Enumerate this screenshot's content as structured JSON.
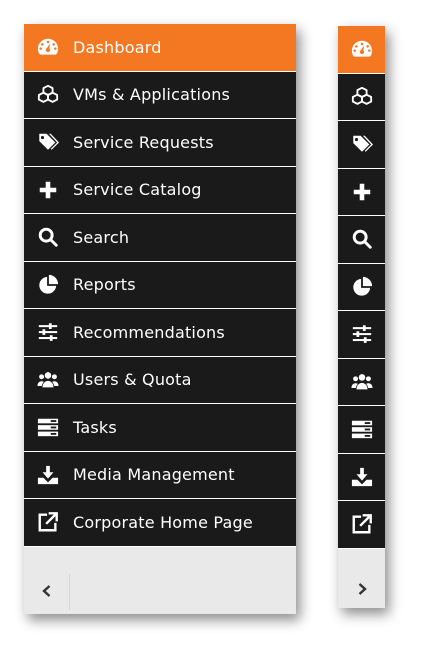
{
  "colors": {
    "active": "#f47721",
    "item_bg": "#1a1a1a",
    "text": "#ffffff",
    "panel_bg": "#e9e9e9"
  },
  "menu": {
    "items": [
      {
        "label": "Dashboard",
        "icon": "dashboard-icon",
        "active": true
      },
      {
        "label": "VMs & Applications",
        "icon": "cubes-icon"
      },
      {
        "label": "Service Requests",
        "icon": "tags-icon"
      },
      {
        "label": "Service Catalog",
        "icon": "plus-icon"
      },
      {
        "label": "Search",
        "icon": "search-icon"
      },
      {
        "label": "Reports",
        "icon": "pie-chart-icon"
      },
      {
        "label": "Recommendations",
        "icon": "sliders-icon"
      },
      {
        "label": "Users & Quota",
        "icon": "users-icon"
      },
      {
        "label": "Tasks",
        "icon": "tasks-icon"
      },
      {
        "label": "Media Management",
        "icon": "download-icon"
      },
      {
        "label": "Corporate Home Page",
        "icon": "external-link-icon"
      }
    ]
  },
  "toggle": {
    "collapse_icon": "chevron-left-icon",
    "expand_icon": "chevron-right-icon"
  }
}
